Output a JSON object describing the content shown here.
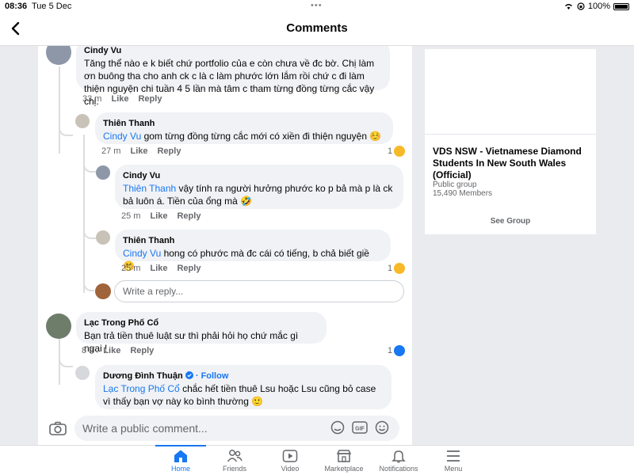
{
  "status": {
    "time": "08:36",
    "date": "Tue 5 Dec",
    "battery": "100%"
  },
  "header": {
    "title": "Comments"
  },
  "comments": [
    {
      "name": "Cindy Vu",
      "text": "Tăng thể nào e k biết chứ portfolio của e còn chưa về đc bờ. Chị làm ơn buông tha cho anh ck c là c làm phước lớn lắm rồi chứ c đi làm thiện nguyện chi tuần 4 5 lần mà tâm c tham từng đồng từng cắc vậy chị.",
      "time": "33 m",
      "like": "Like",
      "reply": "Reply"
    },
    {
      "name": "Thiên Thanh",
      "mention": "Cindy Vu",
      "text": " gom từng đồng từng cắc mới có xiền đi thiện nguyện ☺️",
      "time": "27 m",
      "like": "Like",
      "reply": "Reply",
      "reactions": "1"
    },
    {
      "name": "Cindy Vu",
      "mention": "Thiên Thanh",
      "text": " vậy tính ra người hưởng phước ko p bả mà p là ck bả luôn á. Tiền của ổng mà 🤣",
      "time": "25 m",
      "like": "Like",
      "reply": "Reply"
    },
    {
      "name": "Thiên Thanh",
      "mention": "Cindy Vu",
      "text": " hong có phước mà đc cái có tiếng, b chả biết giề 🤭",
      "time": "25 m",
      "like": "Like",
      "reply": "Reply",
      "reactions": "1"
    },
    {
      "name": "Lạc Trong Phố Cổ",
      "text": "Bạn trả tiền thuê luật sư thì phải hỏi họ chứ mắc gì ngại !",
      "time": "8 h",
      "like": "Like",
      "reply": "Reply",
      "reactions": "1"
    },
    {
      "name": "Dương Đình Thuận",
      "follow": "· Follow",
      "mention": "Lạc Trong Phố Cổ",
      "text": " chắc hết tiền thuê Lsu hoặc Lsu cũng bỏ case vì thấy bạn vợ này ko bình thường 🙂"
    }
  ],
  "reply_input": {
    "placeholder": "Write a reply..."
  },
  "group": {
    "name": "VDS NSW - Vietnamese Diamond Students In New South Wales (Official)",
    "type": "Public group",
    "members": "15,490 Members",
    "cta": "See Group"
  },
  "composer": {
    "placeholder": "Write a public comment..."
  },
  "tabs": [
    {
      "label": "Home",
      "icon": "home-icon",
      "active": true
    },
    {
      "label": "Friends",
      "icon": "friends-icon"
    },
    {
      "label": "Video",
      "icon": "video-icon"
    },
    {
      "label": "Marketplace",
      "icon": "marketplace-icon"
    },
    {
      "label": "Notifications",
      "icon": "bell-icon"
    },
    {
      "label": "Menu",
      "icon": "menu-icon"
    }
  ],
  "colors": {
    "accent": "#1877f2",
    "bubble": "#f0f2f5",
    "secondary_text": "#65676b"
  }
}
